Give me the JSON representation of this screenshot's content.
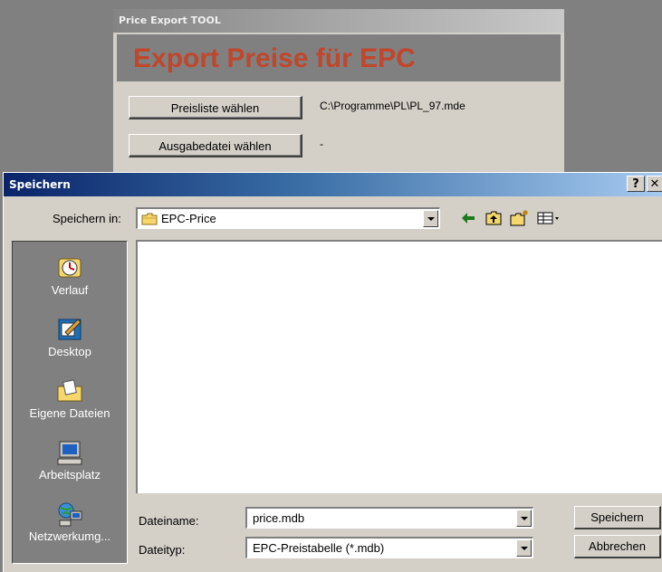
{
  "app": {
    "title": "Price Export TOOL",
    "header_title": "Export Preise für EPC",
    "choose_pricelist_label": "Preisliste wählen",
    "pricelist_path": "C:\\Programme\\PL\\PL_97.mde",
    "choose_output_label": "Ausgabedatei wählen",
    "output_path": "-",
    "header_text_color": "#c0462c"
  },
  "dialog": {
    "title": "Speichern",
    "help_button": "?",
    "close_button": "✕",
    "save_in_label": "Speichern in:",
    "save_in_value": "EPC-Price",
    "toolbar_icons": [
      "back-icon",
      "up-folder-icon",
      "new-folder-icon",
      "view-menu-icon"
    ],
    "places": [
      {
        "label": "Verlauf",
        "icon": "history-icon"
      },
      {
        "label": "Desktop",
        "icon": "desktop-icon"
      },
      {
        "label": "Eigene Dateien",
        "icon": "my-documents-icon"
      },
      {
        "label": "Arbeitsplatz",
        "icon": "my-computer-icon"
      },
      {
        "label": "Netzwerkumg...",
        "icon": "network-icon"
      }
    ],
    "filename_label": "Dateiname:",
    "filename_value": "price.mdb",
    "filetype_label": "Dateityp:",
    "filetype_value": "EPC-Preistabelle (*.mdb)",
    "save_button": "Speichern",
    "cancel_button": "Abbrechen",
    "titlebar_color": "#0a246a"
  }
}
